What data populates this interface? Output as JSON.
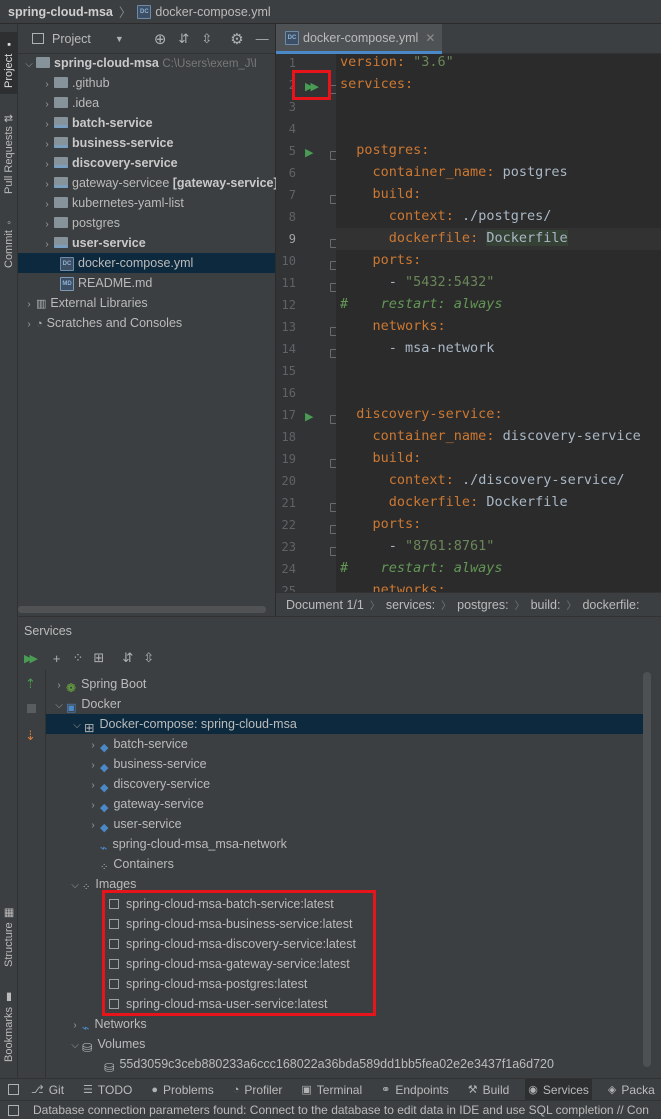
{
  "navbar": {
    "project": "spring-cloud-msa",
    "file": "docker-compose.yml"
  },
  "left_stripe": {
    "project": "Project",
    "pull_requests": "Pull Requests",
    "commit": "Commit",
    "structure": "Structure",
    "bookmarks": "Bookmarks"
  },
  "project_panel": {
    "title": "Project",
    "root": {
      "name": "spring-cloud-msa",
      "path": "C:\\Users\\exem_J\\I"
    },
    "items": [
      {
        "label": ".github"
      },
      {
        "label": ".idea"
      },
      {
        "label": "batch-service"
      },
      {
        "label": "business-service"
      },
      {
        "label": "discovery-service"
      },
      {
        "label": "gateway-servicee",
        "suffix": "[gateway-service]"
      },
      {
        "label": "kubernetes-yaml-list"
      },
      {
        "label": "postgres"
      },
      {
        "label": "user-service"
      },
      {
        "label": "docker-compose.yml"
      },
      {
        "label": "README.md"
      },
      {
        "label": "External Libraries"
      },
      {
        "label": "Scratches and Consoles"
      }
    ]
  },
  "editor": {
    "tab": "docker-compose.yml",
    "lines": [
      {
        "n": "1"
      },
      {
        "n": "2"
      },
      {
        "n": "3"
      },
      {
        "n": "4"
      },
      {
        "n": "5"
      },
      {
        "n": "6"
      },
      {
        "n": "7"
      },
      {
        "n": "8"
      },
      {
        "n": "9"
      },
      {
        "n": "10"
      },
      {
        "n": "11"
      },
      {
        "n": "12"
      },
      {
        "n": "13"
      },
      {
        "n": "14"
      },
      {
        "n": "15"
      },
      {
        "n": "16"
      },
      {
        "n": "17"
      },
      {
        "n": "18"
      },
      {
        "n": "19"
      },
      {
        "n": "20"
      },
      {
        "n": "21"
      },
      {
        "n": "22"
      },
      {
        "n": "23"
      },
      {
        "n": "24"
      },
      {
        "n": "25"
      }
    ],
    "code": {
      "l1k": "version",
      "l1v": "\"3.6\"",
      "l2k": "services",
      "l5k": "postgres",
      "l6k": "container_name",
      "l6v": "postgres",
      "l7k": "build",
      "l8k": "context",
      "l8v": "./postgres/",
      "l9k": "dockerfile",
      "l9v": "Dockerfile",
      "l10k": "ports",
      "l11v": "\"5432:5432\"",
      "l12c": "#    restart: always",
      "l13k": "networks",
      "l14v": "msa-network",
      "l17k": "discovery-service",
      "l18k": "container_name",
      "l18v": "discovery-service",
      "l19k": "build",
      "l20k": "context",
      "l20v": "./discovery-service/",
      "l21k": "dockerfile",
      "l21v": "Dockerfile",
      "l22k": "ports",
      "l23v": "\"8761:8761\"",
      "l24c": "#    restart: always",
      "l25k": "networks"
    },
    "breadcrumbs": [
      "Document 1/1",
      "services:",
      "postgres:",
      "build:",
      "dockerfile:"
    ]
  },
  "services": {
    "title": "Services",
    "tree": {
      "spring_boot": "Spring Boot",
      "docker": "Docker",
      "compose": "Docker-compose: spring-cloud-msa",
      "compose_services": [
        "batch-service",
        "business-service",
        "discovery-service",
        "gateway-service",
        "user-service"
      ],
      "network": "spring-cloud-msa_msa-network",
      "containers": "Containers",
      "images": "Images",
      "image_list": [
        "spring-cloud-msa-batch-service:latest",
        "spring-cloud-msa-business-service:latest",
        "spring-cloud-msa-discovery-service:latest",
        "spring-cloud-msa-gateway-service:latest",
        "spring-cloud-msa-postgres:latest",
        "spring-cloud-msa-user-service:latest"
      ],
      "networks": "Networks",
      "volumes": "Volumes",
      "volume_id": "55d3059c3ceb880233a6ccc168022a36bda589dd1bb5fea02e2e3437f1a6d720"
    }
  },
  "tool_windows": [
    "Git",
    "TODO",
    "Problems",
    "Profiler",
    "Terminal",
    "Endpoints",
    "Build",
    "Services",
    "Packa"
  ],
  "status": "Database connection parameters found: Connect to the database to edit data in IDE and use SQL completion // Con",
  "colors": {
    "keyword": "#cc7832",
    "string": "#6a8759",
    "comment": "#629755",
    "selection": "#0d293e",
    "highlight_box": "#e8141b",
    "run": "#499c54"
  }
}
